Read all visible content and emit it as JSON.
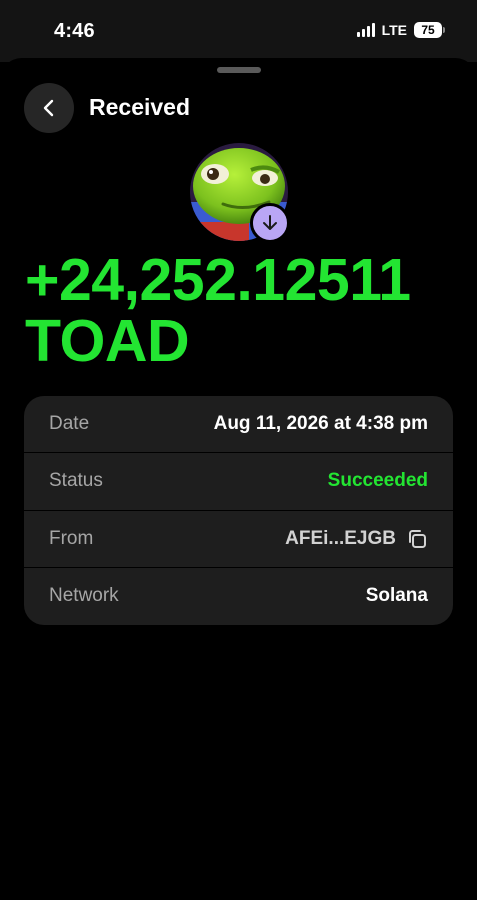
{
  "status_bar": {
    "time": "4:46",
    "network": "LTE",
    "battery": "75"
  },
  "header": {
    "title": "Received",
    "back_icon": "chevron-left-icon"
  },
  "token": {
    "avatar": "toad-token-avatar",
    "badge_icon": "arrow-down-icon",
    "amount_line1": "+24,252.12511",
    "amount_line2": "TOAD",
    "amount_color": "#23e532"
  },
  "details": {
    "rows": [
      {
        "label": "Date",
        "value": "Aug 11, 2026 at 4:38 pm"
      },
      {
        "label": "Status",
        "value": "Succeeded"
      },
      {
        "label": "From",
        "value": "AFEi...EJGB"
      },
      {
        "label": "Network",
        "value": "Solana"
      }
    ],
    "copy_icon": "copy-icon",
    "success_color": "#23e532"
  },
  "colors": {
    "background": "#000000",
    "card": "#1e1e1e",
    "badge": "#b9a6f5"
  }
}
